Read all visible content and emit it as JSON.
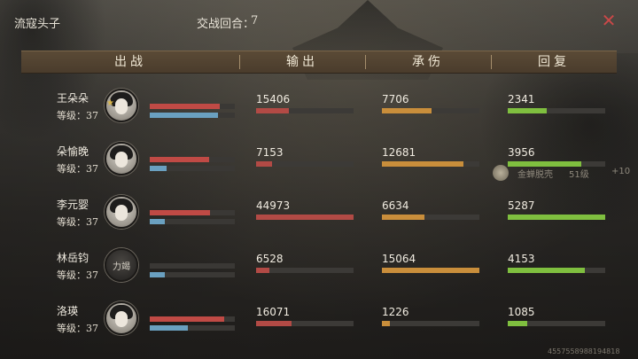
{
  "topbar": {
    "team_name": "流寇头子",
    "round_label": "交战回合：",
    "round_value": "7"
  },
  "header": {
    "col1": "出战",
    "col2": "输出",
    "col3": "承伤",
    "col4": "回复"
  },
  "colors": {
    "output": "#b24a45",
    "damage": "#c98e3b",
    "heal": "#7fbf3f",
    "hp": "#c04a45",
    "mp": "#6aa0c0"
  },
  "players": [
    {
      "name": "王朵朵",
      "level": "等级：37",
      "hp": 0.82,
      "mp": 0.8,
      "starred": true,
      "avatar_icon": "portrait-icon",
      "output": "15406",
      "output_frac": 0.34,
      "damage": "7706",
      "damage_frac": 0.51,
      "heal": "2341",
      "heal_frac": 0.4
    },
    {
      "name": "朵愉晚",
      "level": "等级：37",
      "hp": 0.7,
      "mp": 0.2,
      "starred": false,
      "avatar_icon": "portrait-icon",
      "output": "7153",
      "output_frac": 0.16,
      "damage": "12681",
      "damage_frac": 0.84,
      "heal": "3956",
      "heal_frac": 0.75
    },
    {
      "name": "李元婴",
      "level": "等级：37",
      "hp": 0.71,
      "mp": 0.18,
      "starred": false,
      "avatar_icon": "portrait-icon",
      "output": "44973",
      "output_frac": 1.0,
      "damage": "6634",
      "damage_frac": 0.44,
      "heal": "5287",
      "heal_frac": 1.0
    },
    {
      "name": "林岳钧",
      "level": "等级：37",
      "hp": 0.0,
      "mp": 0.18,
      "starred": false,
      "avatar_icon": "portrait-icon",
      "avatar_text": "力竭",
      "output": "6528",
      "output_frac": 0.14,
      "damage": "15064",
      "damage_frac": 1.0,
      "heal": "4153",
      "heal_frac": 0.79
    },
    {
      "name": "洛瑛",
      "level": "等级：37",
      "hp": 0.88,
      "mp": 0.45,
      "starred": false,
      "avatar_icon": "portrait-icon",
      "output": "16071",
      "output_frac": 0.36,
      "damage": "1226",
      "damage_frac": 0.08,
      "heal": "1085",
      "heal_frac": 0.2
    }
  ],
  "buff": {
    "name": "金蝉脱壳",
    "level": "51级",
    "bonus": "+10",
    "icon": "buff-icon"
  },
  "footer_id": "4557558988194818"
}
